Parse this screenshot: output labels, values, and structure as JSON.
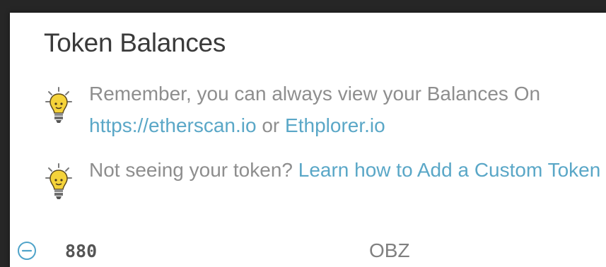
{
  "panel": {
    "title": "Token Balances"
  },
  "tips": [
    {
      "icon": "lightbulb-icon",
      "text_prefix": "Remember, you can always view your Balances On ",
      "link1": "https://etherscan.io",
      "middle": " or ",
      "link2": "Ethplorer.io"
    },
    {
      "icon": "lightbulb-icon",
      "text_prefix": "Not seeing your token? ",
      "link1": "Learn how to Add a Custom Token"
    }
  ],
  "token_row": {
    "icon": "minus-circle-icon",
    "amount": "880",
    "symbol": "OBZ"
  },
  "colors": {
    "link": "#5aa7c7",
    "tip_text": "#8e8e8e",
    "title": "#3a3a3a",
    "bulb": "#f5d33a",
    "remove_icon": "#4fa3c9"
  }
}
